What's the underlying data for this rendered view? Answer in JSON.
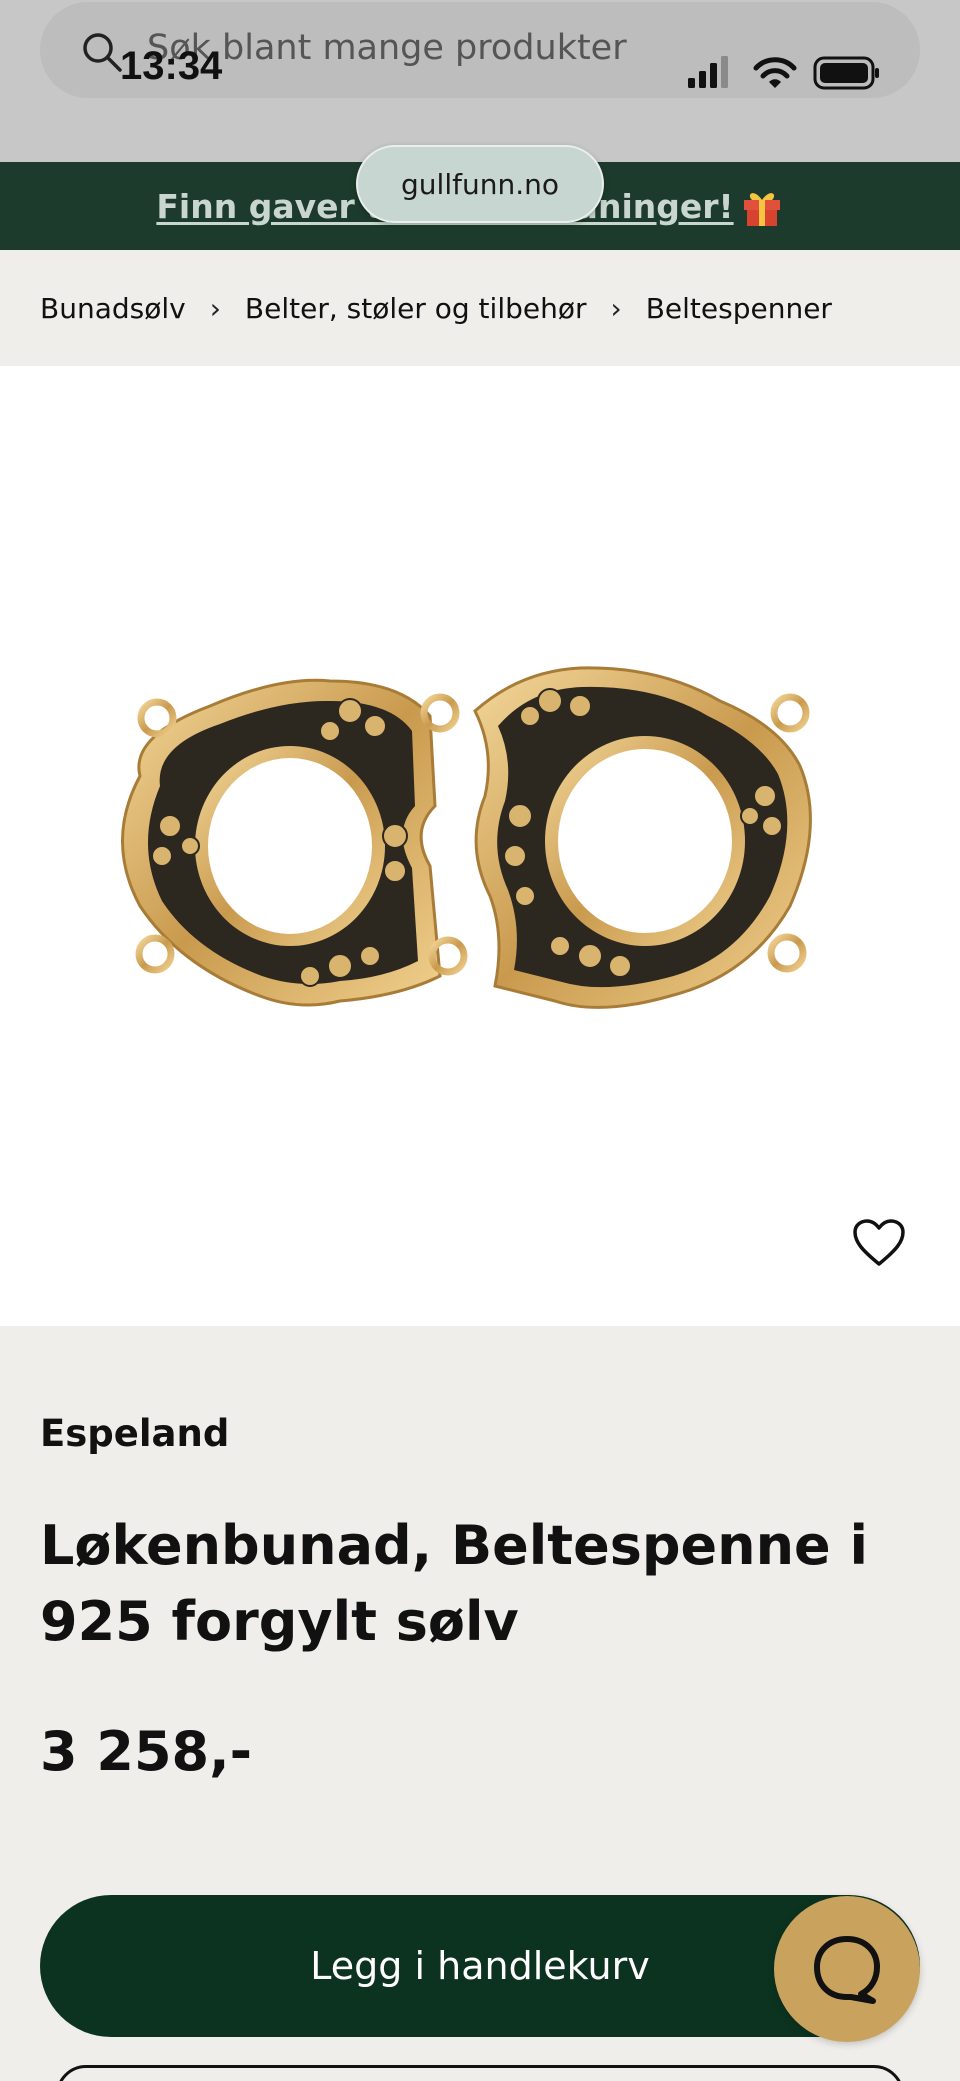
{
  "status_bar": {
    "time": "13:34"
  },
  "search": {
    "placeholder": "Søk blant mange produkter"
  },
  "browser": {
    "url": "gullfunn.no"
  },
  "promo": {
    "text": "Finn gaver til alle anledninger!"
  },
  "breadcrumb": {
    "items": [
      {
        "label": "Bunadsølv"
      },
      {
        "label": "Belter, støler og tilbehør"
      },
      {
        "label": "Beltespenner"
      }
    ]
  },
  "product": {
    "brand": "Espeland",
    "title": "Løkenbunad, Beltespenne i 925 forgylt sølv",
    "price": "3 258,-",
    "add_to_cart_label": "Legg i handlekurv"
  },
  "colors": {
    "promo_bg": "#1d3b2c",
    "cart_button_bg": "#0c3320",
    "chat_button_bg": "#c9a35e",
    "page_bg": "#f0eeeb"
  },
  "icons": [
    "search-icon",
    "signal-icon",
    "wifi-icon",
    "battery-icon",
    "gift-icon",
    "chevron-right-icon",
    "heart-icon",
    "chat-icon"
  ]
}
